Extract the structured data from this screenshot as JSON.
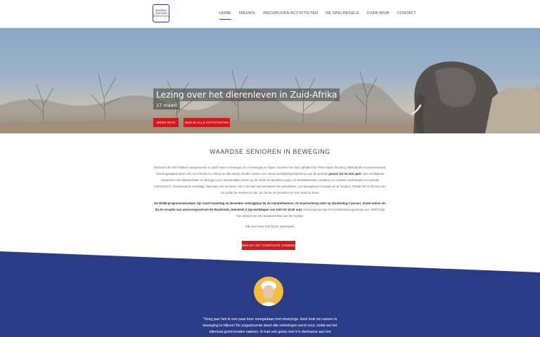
{
  "logo": {
    "lines": [
      "WAARDSE",
      "SENIOREN",
      "IN BEWEGING"
    ]
  },
  "nav": {
    "items": [
      {
        "label": "HOME",
        "active": true
      },
      {
        "label": "NIEUWS",
        "active": false
      },
      {
        "label": "INSCHRIJVEN ACTIVITEITEN",
        "active": false
      },
      {
        "label": "DE SPELREGELS",
        "active": false
      },
      {
        "label": "OVER WSIB",
        "active": false
      },
      {
        "label": "CONTACT",
        "active": false
      }
    ]
  },
  "hero": {
    "title": "Lezing over het dierenleven in Zuid-Afrika",
    "date": "17 maart",
    "button_more": "MEER INFO",
    "button_all": "BEKIJK ALLE ACTIVITEITEN",
    "slide_count": 7,
    "active_slide": 0
  },
  "intro": {
    "title": "WAARDSE SENIOREN IN BEWEGING",
    "p1_a": "Senioren die zich hebben voorgenomen in 2020 meer te bewegen en in beweging te blijven, kunnen hun hart ophalen! De Pieter Baan Stichting, Bibliotheek Kennemerwaard, Heerhugowaard Sport, MC Cool kunst en cultuur en Met welzijn bieden samen een nieuw activiteitenprogramma voor de periode ",
    "p1_b": "januari tot en met april",
    "p1_c": ". Van meditatieve momenten met klankschalen en lezingen over avontuurlijke reizen op de motor tot sportieve yoga- en wandelsessies, creatieve en culinaire workshops en muzikale intermezzo's. Verrassend & veelzijdig. Speciaal voor senioren. Om u te laten kennismaken met activiteiten, u in beweging te brengen en te houden. Omdat het zo fijn kan zijn om onder de mensen te zijn, de zinnen te verzetten en 'iets' leuks te doen.",
    "p2_bold": "De WSIB-programmaboekjes zijn vanaf maandag 16 december verkrijgbaar bij de initiatiefnemers. De kaartverkoop start op donderdag 2 januari. Zowel online als bij de receptie van woonzorgcentrum De Raadsiede, Dekamiet 2 (op werkdagen van 9.00 tot 16.00 uur).",
    "p2_rest": " Nieuwsgierig naar het activiteitenprogramma voor 2020? Kijk hier alvast voor een sneakpreview van het boekje!",
    "p3": "Klik voor meer info bij De Spelregels.",
    "button": "BEKIJK HET COMPLETE AANBOD"
  },
  "testimonial": {
    "quote": "\"Vorig jaar heb ik een paar keer meegedaan met stoelyoga. Heel leuk om samen in beweging te blijven! De yogadocente deed alle oefeningen eerst voor, zodat we het allemaal goed konden nadoen. Ik had ook geluk met m'n deelname aan het verwenmoment bij de"
  },
  "colors": {
    "brand_blue": "#2a3c86",
    "brand_red": "#d3181b"
  }
}
